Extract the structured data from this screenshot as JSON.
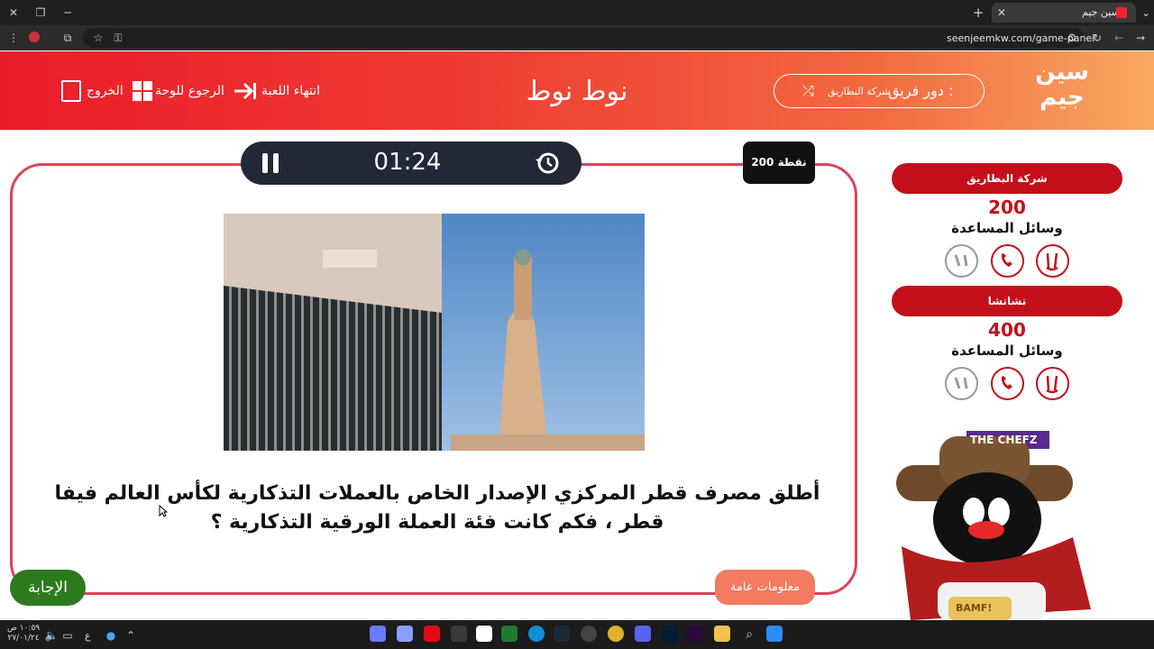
{
  "browser": {
    "tab_title": "سين جيم",
    "url": "seenjeemkw.com/game-panel"
  },
  "header": {
    "logo_text": "سين جيم",
    "game_title": "نوط نوط",
    "turn_label": "دور فريق :",
    "turn_team": "شركة البطاريق",
    "end_game": "انتهاء اللعبة",
    "back_to_board": "الرجوع للوحة",
    "exit": "الخروج"
  },
  "question": {
    "timer": "01:24",
    "points": "200 نقطة",
    "text": "أطلق مصرف قطر المركزي الإصدار الخاص بالعملات التذكارية لكأس العالم فيفا قطر ، فكم كانت فئة العملة الورقية التذكارية ؟",
    "category": "معلومات عامة",
    "answer_button": "الإجابة"
  },
  "teams": [
    {
      "name": "شركة البطاريق",
      "score": "200",
      "aids_label": "وسائل المساعدة"
    },
    {
      "name": "تشاتشا",
      "score": "400",
      "aids_label": "وسائل المساعدة"
    }
  ],
  "overlay": {
    "brand": "THE CHEFZ",
    "badge": "BAMF!"
  },
  "taskbar": {
    "time": "١٠:٥٩ ص",
    "date": "٢٧/٠١/٢٤",
    "lang": "ع"
  },
  "colors": {
    "header_red": "#ea1c2a",
    "team_red": "#c40f1a",
    "card_border": "#d9445a",
    "answer_green": "#2d7a1e",
    "category_coral": "#f47a60",
    "timer_navy": "#222838"
  }
}
